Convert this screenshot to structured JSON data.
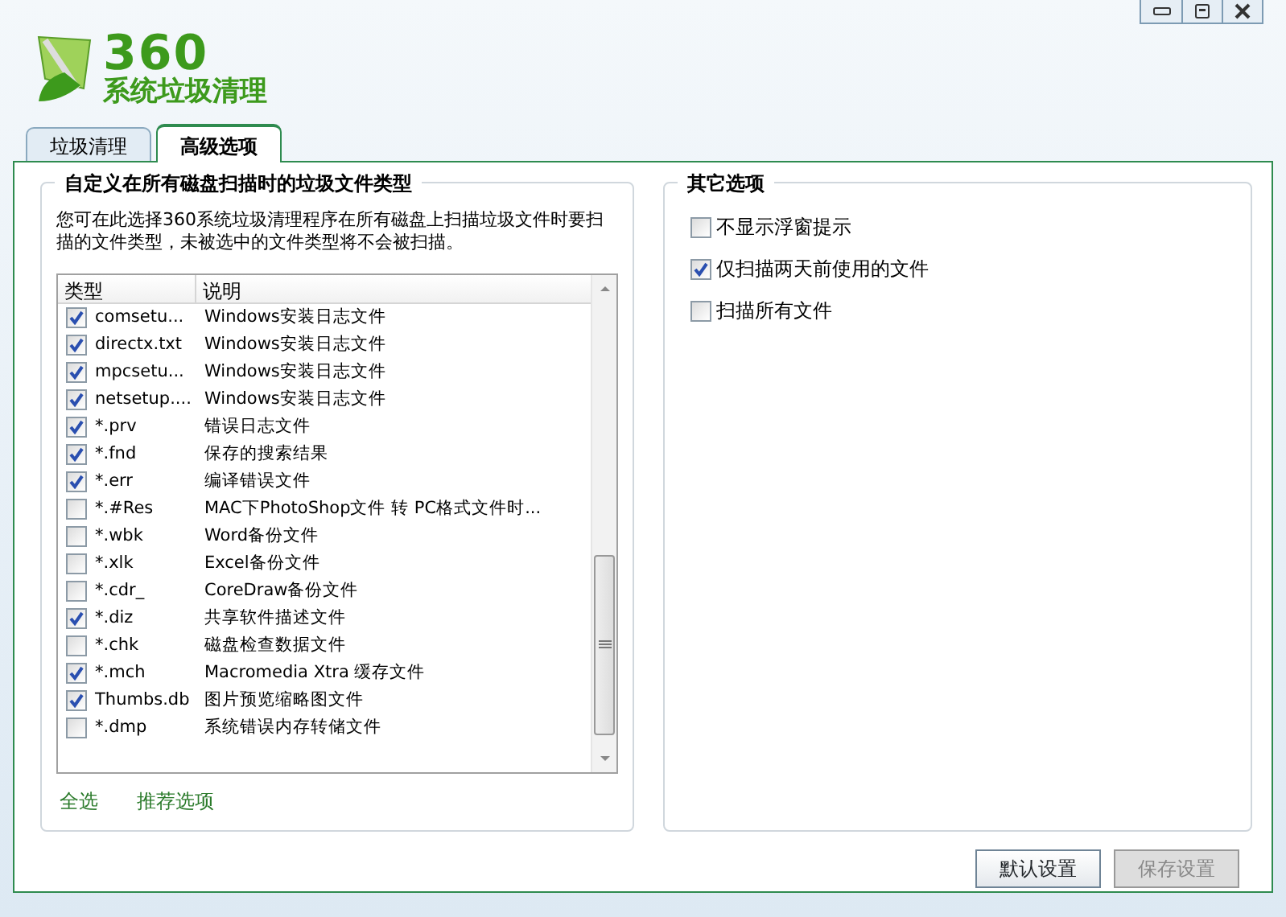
{
  "logo": {
    "number": "360",
    "title": "系统垃圾清理"
  },
  "tabs": [
    {
      "label": "垃圾清理",
      "selected": false
    },
    {
      "label": "高级选项",
      "selected": true
    }
  ],
  "left_group": {
    "title": "自定义在所有磁盘扫描时的垃圾文件类型",
    "description": "您可在此选择360系统垃圾清理程序在所有磁盘上扫描垃圾文件时要扫描的文件类型，未被选中的文件类型将不会被扫描。",
    "table": {
      "columns": [
        "类型",
        "说明"
      ],
      "rows": [
        {
          "type": "comsetu...",
          "description": "Windows安装日志文件",
          "checked": true
        },
        {
          "type": "directx.txt",
          "description": "Windows安装日志文件",
          "checked": true
        },
        {
          "type": "mpcsetu...",
          "description": "Windows安装日志文件",
          "checked": true
        },
        {
          "type": "netsetup....",
          "description": "Windows安装日志文件",
          "checked": true
        },
        {
          "type": "*.prv",
          "description": "错误日志文件",
          "checked": true
        },
        {
          "type": "*.fnd",
          "description": "保存的搜索结果",
          "checked": true
        },
        {
          "type": "*.err",
          "description": "编译错误文件",
          "checked": true
        },
        {
          "type": "*.#Res",
          "description": "MAC下PhotoShop文件 转 PC格式文件时...",
          "checked": false
        },
        {
          "type": "*.wbk",
          "description": "Word备份文件",
          "checked": false
        },
        {
          "type": "*.xlk",
          "description": "Excel备份文件",
          "checked": false
        },
        {
          "type": "*.cdr_",
          "description": "CoreDraw备份文件",
          "checked": false
        },
        {
          "type": "*.diz",
          "description": "共享软件描述文件",
          "checked": true
        },
        {
          "type": "*.chk",
          "description": "磁盘检查数据文件",
          "checked": false
        },
        {
          "type": "*.mch",
          "description": "Macromedia Xtra 缓存文件",
          "checked": true
        },
        {
          "type": "Thumbs.db",
          "description": "图片预览缩略图文件",
          "checked": true
        },
        {
          "type": "*.dmp",
          "description": "系统错误内存转储文件",
          "checked": false
        }
      ]
    },
    "links": [
      "全选",
      "推荐选项"
    ]
  },
  "right_group": {
    "title": "其它选项",
    "options": [
      {
        "label": "不显示浮窗提示",
        "checked": false
      },
      {
        "label": "仅扫描两天前使用的文件",
        "checked": true
      },
      {
        "label": "扫描所有文件",
        "checked": false
      }
    ]
  },
  "buttons": [
    {
      "label": "默认设置",
      "disabled": false
    },
    {
      "label": "保存设置",
      "disabled": true
    }
  ]
}
